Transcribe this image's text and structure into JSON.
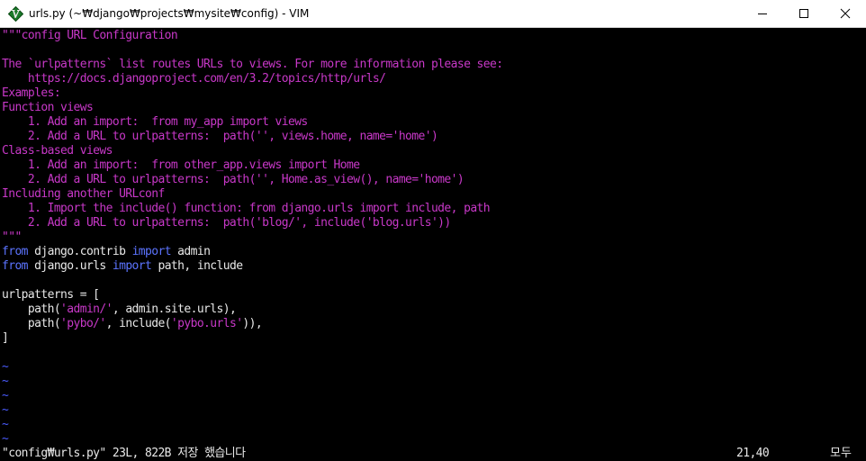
{
  "window": {
    "title": "urls.py (~₩django₩projects₩mysite₩config) - VIM"
  },
  "colors": {
    "docstring": "#c838c8",
    "keyword": "#5c74ff",
    "identifier": "#e8e8e8",
    "tilde": "#4a5cff",
    "background": "#000000"
  },
  "icons": {
    "app": "vim-icon",
    "minimize": "minimize-icon",
    "maximize": "maximize-icon",
    "close": "close-icon"
  },
  "editor": {
    "lines": [
      "\"\"\"config URL Configuration",
      "",
      "The `urlpatterns` list routes URLs to views. For more information please see:",
      "    https://docs.djangoproject.com/en/3.2/topics/http/urls/",
      "Examples:",
      "Function views",
      "    1. Add an import:  from my_app import views",
      "    2. Add a URL to urlpatterns:  path('', views.home, name='home')",
      "Class-based views",
      "    1. Add an import:  from other_app.views import Home",
      "    2. Add a URL to urlpatterns:  path('', Home.as_view(), name='home')",
      "Including another URLconf",
      "    1. Import the include() function: from django.urls import include, path",
      "    2. Add a URL to urlpatterns:  path('blog/', include('blog.urls'))",
      "\"\"\"",
      "from",
      " django.contrib ",
      "import",
      " admin",
      "from",
      " django.urls ",
      "import",
      " path, include",
      "",
      "urlpatterns = [",
      "    path(",
      "'admin/'",
      ", admin.site.urls),",
      "    path(",
      "'pybo/'",
      ", include(",
      "'pybo.urls'",
      ")),",
      "]",
      "~"
    ]
  },
  "status": {
    "message": "\"config₩urls.py\" 23L, 822B 저장 했습니다",
    "position": "21,40",
    "scroll": "모두"
  }
}
